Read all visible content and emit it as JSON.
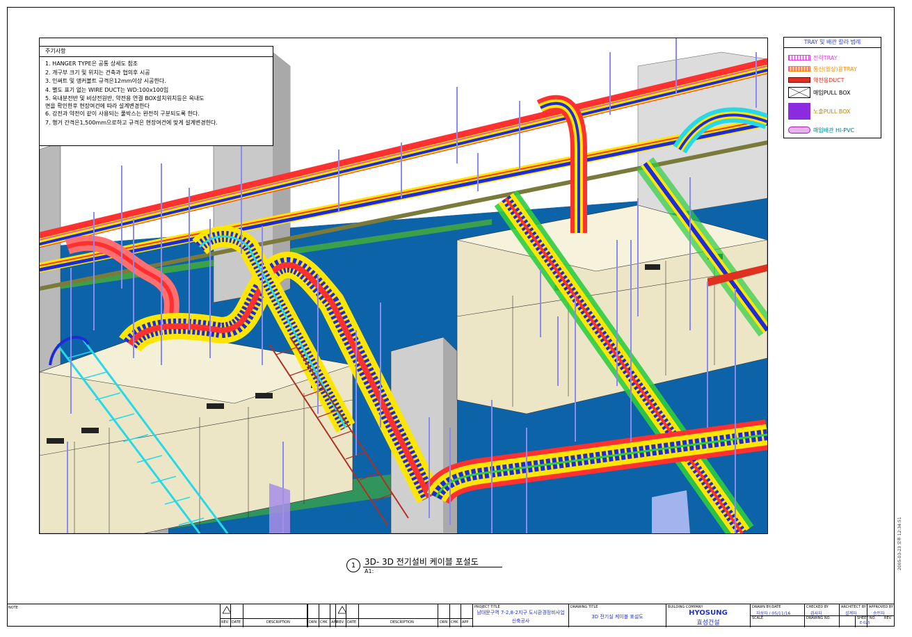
{
  "notes": {
    "header": "주기사항",
    "items": [
      "1. HANGER TYPE은 공통 상세도 참조",
      "2. 개구부 크기 및 위치는 건축과 협의후 시공",
      "3. 인써트 및 앵커볼트 규격은12mm이상 시공한다.",
      "4. 별도 표기 없는 WIRE DUCT는 WD:100x100임",
      "5. 옥내분전반 및 비상전원반, 약전용 연결 BOX설치위치등은 옥내도",
      "면을 확인한후 현장여건에 따라 설계변경한다",
      "6. 강전과 약전이 같이 사용되는 풀박스는 완전히 구분되도록 한다.",
      "7. 행거 간격은1,500mm으로하고 규격은 현장여건에 맞게 설계변경한다."
    ]
  },
  "legend": {
    "header": "TRAY 및 배관 칼라 범례",
    "items": [
      {
        "label": "전력TRAY",
        "color": "#e040e0",
        "icon": "tray-ladder-icon"
      },
      {
        "label": "통신(일상)용TRAY",
        "color": "#ff8c00",
        "icon": "tray-ladder-icon"
      },
      {
        "label": "약전용DUCT",
        "color": "#e03020",
        "icon": "duct-icon"
      },
      {
        "label": "매입PULL BOX",
        "color": "#000000",
        "icon": "pull-box-cross-icon"
      },
      {
        "label": "노출PULL BOX",
        "color": "#8a2be2",
        "icon": "pull-box-solid-icon"
      },
      {
        "label": "매입배관 HI-PVC",
        "color": "#008080",
        "icon": "conduit-icon"
      }
    ]
  },
  "drawing_title": {
    "number": "1",
    "title": "3D- 3D 전기설비 케이블 포설도",
    "scale": "A1:"
  },
  "title_block": {
    "note_label": "NOTE",
    "rev_headers": [
      "REV.",
      "DATE",
      "DESCRIPTION",
      "DRN",
      "CHK",
      "APP"
    ],
    "project_title_label": "PROJECT TITLE",
    "project_title": "남대문구역 7-2,8-2지구 도시환경정비사업",
    "project_title_2": "신축공사",
    "drawing_title_label": "DRAWING TITLE",
    "drawing_title": "3D 전기실 케이블 포설도",
    "building_company_label": "BUILDING COMPANY",
    "company_name_en": "HYOSUNG",
    "company_name_kr": "효성건설",
    "drawn_by_label": "DRAWN BY/DATE",
    "drawn_by": "자상자 / 05/11/16",
    "checked_by_label": "CHECKED BY",
    "checked_by": "검사자",
    "architect_label": "ARCHITECT BY",
    "architect": "설계자",
    "approved_label": "APPROVED BY",
    "approved": "승인자",
    "scale_label": "SCALE",
    "drawing_no_label": "DRAWING NO.",
    "sheet_no_label": "SHEET NO.",
    "sheet_no": "E-025",
    "rev_label": "REV."
  },
  "side_stamp": "2005-03-23 오후 12:34:51",
  "colors": {
    "floor": "#0d63a8",
    "panel": "#ece6c6",
    "column": "#c8c8c8",
    "tray_red": "#ff3030",
    "tray_yellow": "#ffe600",
    "tray_blue": "#1e2bd8",
    "tray_green": "#2ecc40",
    "tray_cyan": "#26d8e8",
    "hanger": "#8a8af0"
  }
}
